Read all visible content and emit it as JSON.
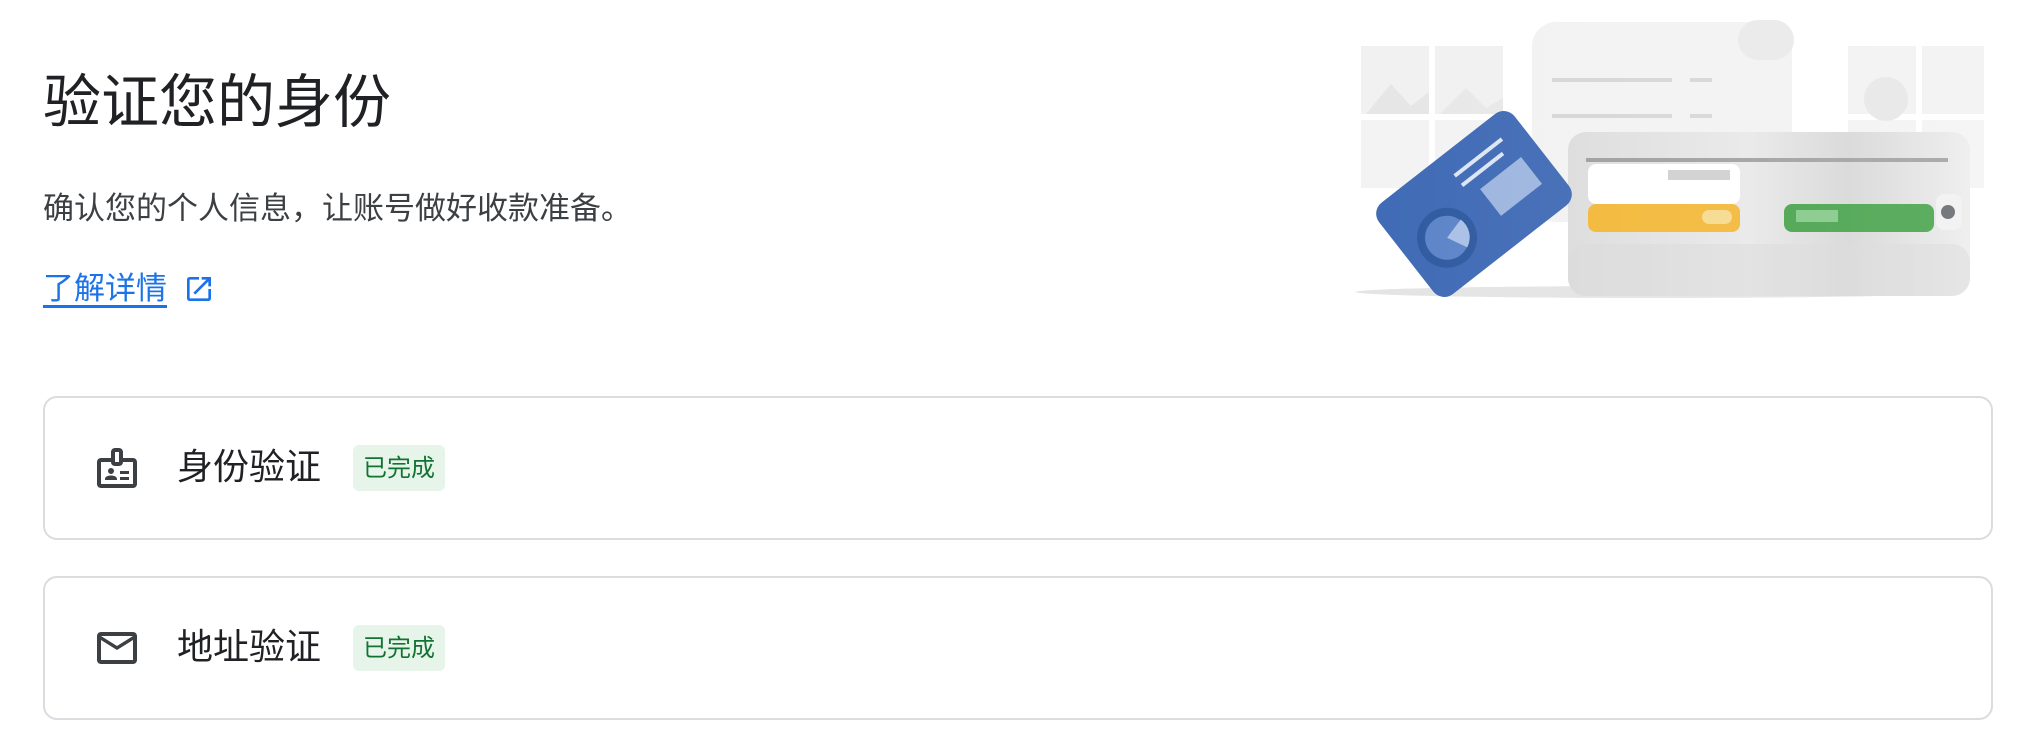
{
  "header": {
    "title": "验证您的身份",
    "subtitle": "确认您的个人信息，让账号做好收款准备。",
    "learn_more_label": "了解详情"
  },
  "verification_items": [
    {
      "label": "身份验证",
      "status": "已完成",
      "icon": "id-badge-icon"
    },
    {
      "label": "地址验证",
      "status": "已完成",
      "icon": "mail-icon"
    }
  ],
  "colors": {
    "link": "#1a73e8",
    "badge_bg": "#e6f4ea",
    "badge_text": "#137333",
    "card_border": "#dadce0",
    "id_card_blue": "#3f6ab5",
    "wallet_yellow": "#f2b736",
    "wallet_green": "#43a047"
  }
}
